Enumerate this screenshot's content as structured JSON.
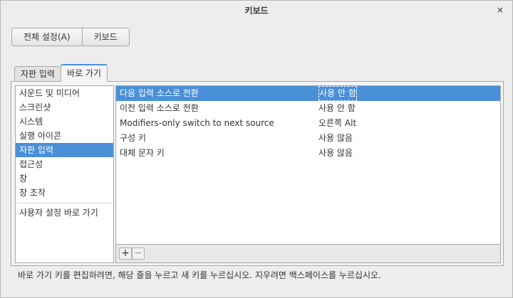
{
  "window": {
    "title": "키보드",
    "close_glyph": "×"
  },
  "switcher": {
    "items": [
      "전체 설정(A)",
      "키보드"
    ]
  },
  "tabs": [
    "자판 입력",
    "바로 가기"
  ],
  "sections": {
    "items": [
      "사운드 및 미디어",
      "스크린샷",
      "시스템",
      "실행 아이콘",
      "자판 입력",
      "접근성",
      "창",
      "창 조작"
    ],
    "selected": "자판 입력",
    "custom": "사용자 설정 바로 가기"
  },
  "shortcuts": {
    "rows": [
      {
        "name": "다음 입력 소스로 전환",
        "accel": "사용 안 함",
        "selected": true
      },
      {
        "name": "이전 입력 소스로 전환",
        "accel": "사용 안 함",
        "selected": false
      },
      {
        "name": "Modifiers-only switch to next source",
        "accel": "오른쪽 Alt",
        "selected": false
      },
      {
        "name": "구성 키",
        "accel": "사용 않음",
        "selected": false
      },
      {
        "name": "대체 문자 키",
        "accel": "사용 않음",
        "selected": false
      }
    ]
  },
  "toolbar": {
    "add_label": "+",
    "remove_label": "−"
  },
  "hint": "바로 가기 키를 편집하려면, 해당 줄을 누르고 새 키를 누르십시오. 지우려면 백스페이스를 누르십시오.",
  "colors": {
    "accent": "#4a90d9",
    "background": "#ededed"
  }
}
